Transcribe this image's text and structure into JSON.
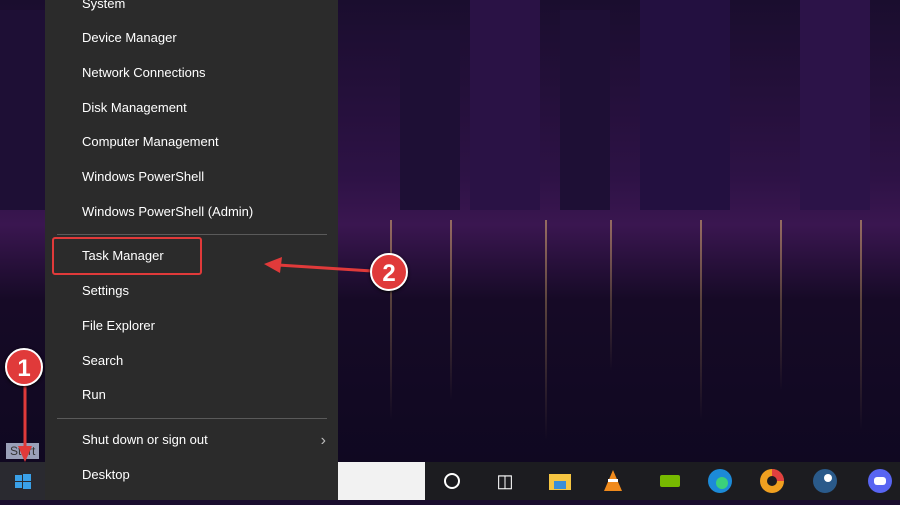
{
  "menu": {
    "items": [
      {
        "label": "System"
      },
      {
        "label": "Device Manager"
      },
      {
        "label": "Network Connections"
      },
      {
        "label": "Disk Management"
      },
      {
        "label": "Computer Management"
      },
      {
        "label": "Windows PowerShell"
      },
      {
        "label": "Windows PowerShell (Admin)"
      },
      {
        "label": "Task Manager"
      },
      {
        "label": "Settings"
      },
      {
        "label": "File Explorer"
      },
      {
        "label": "Search"
      },
      {
        "label": "Run"
      },
      {
        "label": "Shut down or sign out"
      },
      {
        "label": "Desktop"
      }
    ]
  },
  "annotations": {
    "step1": "1",
    "step2": "2",
    "highlight_color": "#e03a3a"
  },
  "taskbar": {
    "start_tooltip": "Start"
  }
}
